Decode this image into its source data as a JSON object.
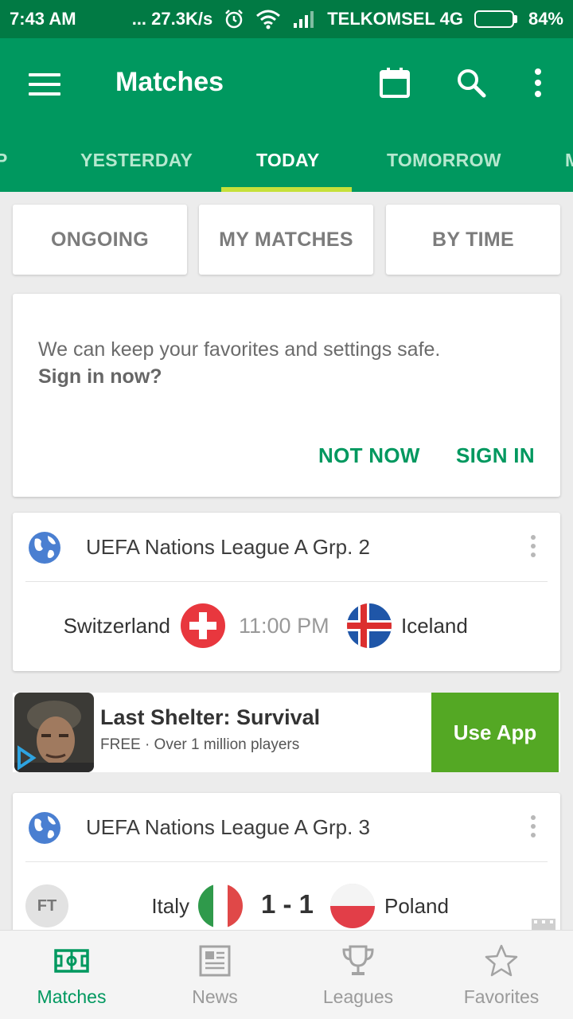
{
  "status_bar": {
    "time": "7:43 AM",
    "speed": "... 27.3K/s",
    "carrier": "TELKOMSEL 4G",
    "battery": "84%",
    "battery_level": 0.84,
    "icons": [
      "alarm-icon",
      "wifi-icon",
      "signal-icon",
      "battery-icon"
    ]
  },
  "app_bar": {
    "title": "Matches",
    "actions": [
      "menu-icon",
      "calendar-icon",
      "search-icon",
      "more-vert-icon"
    ]
  },
  "tabs": [
    {
      "label": "P",
      "active": false
    },
    {
      "label": "YESTERDAY",
      "active": false
    },
    {
      "label": "TODAY",
      "active": true
    },
    {
      "label": "TOMORROW",
      "active": false
    },
    {
      "label": "M",
      "active": false
    }
  ],
  "filters": [
    {
      "label": "ONGOING"
    },
    {
      "label": "MY MATCHES"
    },
    {
      "label": "BY TIME"
    }
  ],
  "signin_card": {
    "message": "We can keep your favorites and settings safe.",
    "question": "Sign in now?",
    "not_now_label": "NOT NOW",
    "sign_in_label": "SIGN IN"
  },
  "leagues": [
    {
      "name": "UEFA Nations League A Grp. 2",
      "match": {
        "home": "Switzerland",
        "away": "Iceland",
        "time": "11:00 PM"
      }
    },
    {
      "name": "UEFA Nations League A Grp. 3",
      "match": {
        "status": "FT",
        "home": "Italy",
        "away": "Poland",
        "score": "1 - 1"
      }
    }
  ],
  "ad": {
    "title": "Last Shelter: Survival",
    "subtitle": "FREE · Over 1 million players",
    "cta": "Use App"
  },
  "bottom_nav": [
    {
      "label": "Matches",
      "icon": "pitch-icon",
      "active": true
    },
    {
      "label": "News",
      "icon": "newspaper-icon",
      "active": false
    },
    {
      "label": "Leagues",
      "icon": "trophy-icon",
      "active": false
    },
    {
      "label": "Favorites",
      "icon": "star-icon",
      "active": false
    }
  ],
  "colors": {
    "status_bar": "#017a44",
    "app_bar": "#00985f",
    "tab_indicator": "#c6e03a",
    "accent": "#00985f",
    "ad_button": "#54a824"
  }
}
